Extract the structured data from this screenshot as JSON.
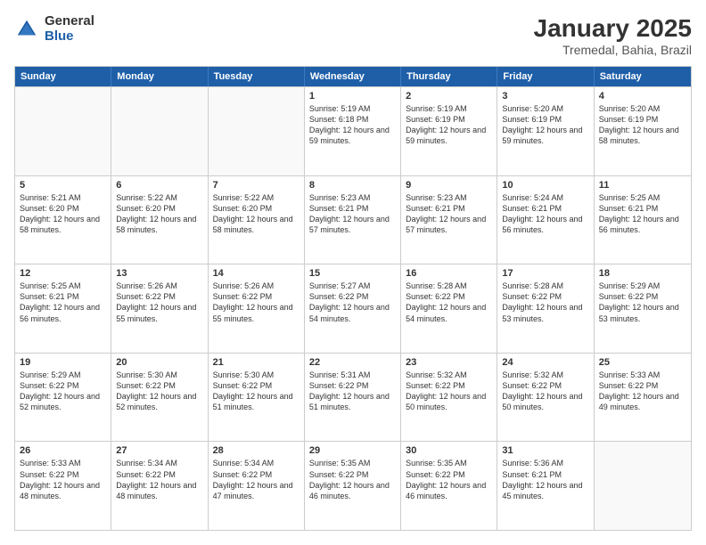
{
  "logo": {
    "general": "General",
    "blue": "Blue"
  },
  "title": {
    "month": "January 2025",
    "location": "Tremedal, Bahia, Brazil"
  },
  "header": {
    "days": [
      "Sunday",
      "Monday",
      "Tuesday",
      "Wednesday",
      "Thursday",
      "Friday",
      "Saturday"
    ]
  },
  "weeks": [
    [
      {
        "day": "",
        "empty": true
      },
      {
        "day": "",
        "empty": true
      },
      {
        "day": "",
        "empty": true
      },
      {
        "day": "1",
        "sunrise": "Sunrise: 5:19 AM",
        "sunset": "Sunset: 6:18 PM",
        "daylight": "Daylight: 12 hours and 59 minutes."
      },
      {
        "day": "2",
        "sunrise": "Sunrise: 5:19 AM",
        "sunset": "Sunset: 6:19 PM",
        "daylight": "Daylight: 12 hours and 59 minutes."
      },
      {
        "day": "3",
        "sunrise": "Sunrise: 5:20 AM",
        "sunset": "Sunset: 6:19 PM",
        "daylight": "Daylight: 12 hours and 59 minutes."
      },
      {
        "day": "4",
        "sunrise": "Sunrise: 5:20 AM",
        "sunset": "Sunset: 6:19 PM",
        "daylight": "Daylight: 12 hours and 58 minutes."
      }
    ],
    [
      {
        "day": "5",
        "sunrise": "Sunrise: 5:21 AM",
        "sunset": "Sunset: 6:20 PM",
        "daylight": "Daylight: 12 hours and 58 minutes."
      },
      {
        "day": "6",
        "sunrise": "Sunrise: 5:22 AM",
        "sunset": "Sunset: 6:20 PM",
        "daylight": "Daylight: 12 hours and 58 minutes."
      },
      {
        "day": "7",
        "sunrise": "Sunrise: 5:22 AM",
        "sunset": "Sunset: 6:20 PM",
        "daylight": "Daylight: 12 hours and 58 minutes."
      },
      {
        "day": "8",
        "sunrise": "Sunrise: 5:23 AM",
        "sunset": "Sunset: 6:21 PM",
        "daylight": "Daylight: 12 hours and 57 minutes."
      },
      {
        "day": "9",
        "sunrise": "Sunrise: 5:23 AM",
        "sunset": "Sunset: 6:21 PM",
        "daylight": "Daylight: 12 hours and 57 minutes."
      },
      {
        "day": "10",
        "sunrise": "Sunrise: 5:24 AM",
        "sunset": "Sunset: 6:21 PM",
        "daylight": "Daylight: 12 hours and 56 minutes."
      },
      {
        "day": "11",
        "sunrise": "Sunrise: 5:25 AM",
        "sunset": "Sunset: 6:21 PM",
        "daylight": "Daylight: 12 hours and 56 minutes."
      }
    ],
    [
      {
        "day": "12",
        "sunrise": "Sunrise: 5:25 AM",
        "sunset": "Sunset: 6:21 PM",
        "daylight": "Daylight: 12 hours and 56 minutes."
      },
      {
        "day": "13",
        "sunrise": "Sunrise: 5:26 AM",
        "sunset": "Sunset: 6:22 PM",
        "daylight": "Daylight: 12 hours and 55 minutes."
      },
      {
        "day": "14",
        "sunrise": "Sunrise: 5:26 AM",
        "sunset": "Sunset: 6:22 PM",
        "daylight": "Daylight: 12 hours and 55 minutes."
      },
      {
        "day": "15",
        "sunrise": "Sunrise: 5:27 AM",
        "sunset": "Sunset: 6:22 PM",
        "daylight": "Daylight: 12 hours and 54 minutes."
      },
      {
        "day": "16",
        "sunrise": "Sunrise: 5:28 AM",
        "sunset": "Sunset: 6:22 PM",
        "daylight": "Daylight: 12 hours and 54 minutes."
      },
      {
        "day": "17",
        "sunrise": "Sunrise: 5:28 AM",
        "sunset": "Sunset: 6:22 PM",
        "daylight": "Daylight: 12 hours and 53 minutes."
      },
      {
        "day": "18",
        "sunrise": "Sunrise: 5:29 AM",
        "sunset": "Sunset: 6:22 PM",
        "daylight": "Daylight: 12 hours and 53 minutes."
      }
    ],
    [
      {
        "day": "19",
        "sunrise": "Sunrise: 5:29 AM",
        "sunset": "Sunset: 6:22 PM",
        "daylight": "Daylight: 12 hours and 52 minutes."
      },
      {
        "day": "20",
        "sunrise": "Sunrise: 5:30 AM",
        "sunset": "Sunset: 6:22 PM",
        "daylight": "Daylight: 12 hours and 52 minutes."
      },
      {
        "day": "21",
        "sunrise": "Sunrise: 5:30 AM",
        "sunset": "Sunset: 6:22 PM",
        "daylight": "Daylight: 12 hours and 51 minutes."
      },
      {
        "day": "22",
        "sunrise": "Sunrise: 5:31 AM",
        "sunset": "Sunset: 6:22 PM",
        "daylight": "Daylight: 12 hours and 51 minutes."
      },
      {
        "day": "23",
        "sunrise": "Sunrise: 5:32 AM",
        "sunset": "Sunset: 6:22 PM",
        "daylight": "Daylight: 12 hours and 50 minutes."
      },
      {
        "day": "24",
        "sunrise": "Sunrise: 5:32 AM",
        "sunset": "Sunset: 6:22 PM",
        "daylight": "Daylight: 12 hours and 50 minutes."
      },
      {
        "day": "25",
        "sunrise": "Sunrise: 5:33 AM",
        "sunset": "Sunset: 6:22 PM",
        "daylight": "Daylight: 12 hours and 49 minutes."
      }
    ],
    [
      {
        "day": "26",
        "sunrise": "Sunrise: 5:33 AM",
        "sunset": "Sunset: 6:22 PM",
        "daylight": "Daylight: 12 hours and 48 minutes."
      },
      {
        "day": "27",
        "sunrise": "Sunrise: 5:34 AM",
        "sunset": "Sunset: 6:22 PM",
        "daylight": "Daylight: 12 hours and 48 minutes."
      },
      {
        "day": "28",
        "sunrise": "Sunrise: 5:34 AM",
        "sunset": "Sunset: 6:22 PM",
        "daylight": "Daylight: 12 hours and 47 minutes."
      },
      {
        "day": "29",
        "sunrise": "Sunrise: 5:35 AM",
        "sunset": "Sunset: 6:22 PM",
        "daylight": "Daylight: 12 hours and 46 minutes."
      },
      {
        "day": "30",
        "sunrise": "Sunrise: 5:35 AM",
        "sunset": "Sunset: 6:22 PM",
        "daylight": "Daylight: 12 hours and 46 minutes."
      },
      {
        "day": "31",
        "sunrise": "Sunrise: 5:36 AM",
        "sunset": "Sunset: 6:21 PM",
        "daylight": "Daylight: 12 hours and 45 minutes."
      },
      {
        "day": "",
        "empty": true
      }
    ]
  ]
}
